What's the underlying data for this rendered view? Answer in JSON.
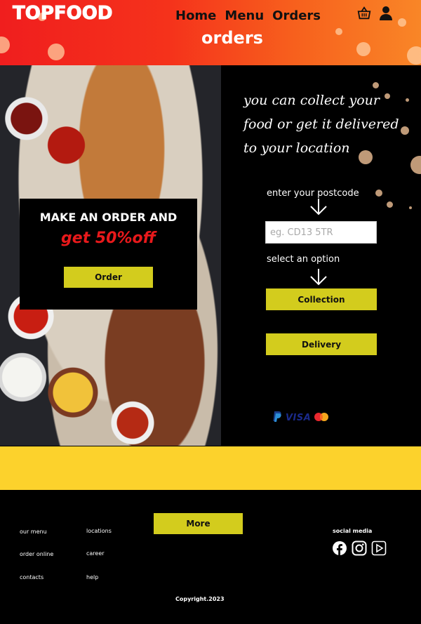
{
  "brand": {
    "logo_text": "TOPFOOD"
  },
  "nav": {
    "items": [
      {
        "label": "Home"
      },
      {
        "label": "Menu"
      },
      {
        "label": "Orders"
      }
    ],
    "icons": [
      "basket-icon",
      "user-icon"
    ]
  },
  "page": {
    "heading": "orders"
  },
  "promo": {
    "title": "MAKE AN ORDER AND",
    "offer": "get 50%off",
    "button_label": "Order"
  },
  "order_panel": {
    "tagline": "you can collect your food or get it delivered to your location",
    "postcode_label": "enter your postcode",
    "postcode_placeholder": "eg. CD13 5TR",
    "postcode_value": "",
    "option_label": "select an option",
    "collection_label": "Collection",
    "delivery_label": "Delivery",
    "payment_methods": [
      "paypal-icon",
      "VISA",
      "mastercard-icon"
    ],
    "visa_text": "VISA"
  },
  "footer": {
    "more_label": "More",
    "links_col1": [
      "our menu",
      "order online",
      "contacts"
    ],
    "links_col2": [
      "locations",
      "career",
      "help"
    ],
    "social_title": "social media",
    "social_icons": [
      "facebook-icon",
      "instagram-icon",
      "youtube-icon"
    ],
    "copyright": "Copyright.2023"
  },
  "colors": {
    "header_gradient_start": "#f01e1e",
    "header_gradient_end": "#f98627",
    "button_yellow": "#d3cc1d",
    "band_yellow": "#fcd22c",
    "offer_red": "#e8191b",
    "background": "#000000"
  }
}
